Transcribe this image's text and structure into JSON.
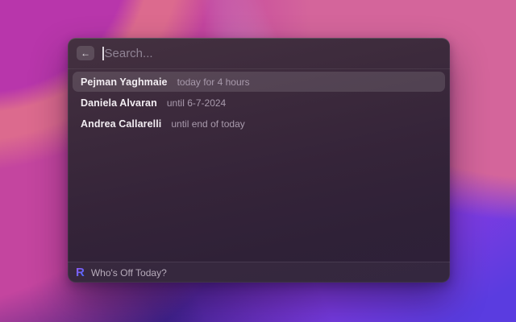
{
  "window": {
    "search": {
      "placeholder": "Search...",
      "back_icon": "←"
    },
    "results": [
      {
        "name": "Pejman Yaghmaie",
        "detail": "today for 4 hours",
        "selected": true
      },
      {
        "name": "Daniela Alvaran",
        "detail": "until 6-7-2024",
        "selected": false
      },
      {
        "name": "Andrea Callarelli",
        "detail": "until end of today",
        "selected": false
      }
    ],
    "footer": {
      "logo_letter": "R",
      "app_label": "Who's Off Today?"
    }
  },
  "colors": {
    "selection_highlight": "rgba(255,255,255,0.12)",
    "logo_gradient_start": "#8a5cfa",
    "logo_gradient_end": "#4c6cfa",
    "window_background_top": "#443140",
    "window_background_bottom": "#2d2038"
  }
}
